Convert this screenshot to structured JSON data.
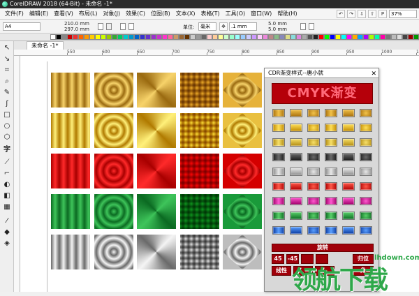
{
  "window": {
    "title": "CorelDRAW 2018 (64-Bit) - 未命名 -1*"
  },
  "menu": {
    "items": [
      "文件(F)",
      "编辑(E)",
      "查看(V)",
      "布局(L)",
      "对象(J)",
      "效果(C)",
      "位图(B)",
      "文本(X)",
      "表格(T)",
      "工具(O)",
      "窗口(W)",
      "帮助(H)"
    ],
    "zoom": "37%"
  },
  "propbar": {
    "page_size": "A4",
    "width": "210.0 mm",
    "height": "297.0 mm",
    "unit_label": "单位:",
    "unit_value": "毫米",
    "nudge": ".1 mm",
    "dup_x": "5.0 mm",
    "dup_y": "5.0 mm"
  },
  "tab": {
    "label": "未命名 -1*"
  },
  "ruler": {
    "labels": [
      "550",
      "600",
      "650",
      "700",
      "750",
      "800",
      "850",
      "900",
      "950",
      "1000",
      "1050"
    ]
  },
  "panel": {
    "title": "CDR渐变样式--唐小就",
    "banner": "CMYK渐变",
    "rotate_label": "旋转",
    "angle_buttons": [
      "45",
      "-45",
      "",
      "",
      "归位"
    ],
    "bottom_buttons": [
      "线性",
      "",
      "",
      "角"
    ]
  },
  "watermark": {
    "text": "领航下载",
    "url": "lhdown.com"
  },
  "colors": {
    "red": "#d40000",
    "green": "#1a9a3a",
    "gold": "#d9a520",
    "silver": "#bdbdbd",
    "panel_red": "#a0000a"
  }
}
